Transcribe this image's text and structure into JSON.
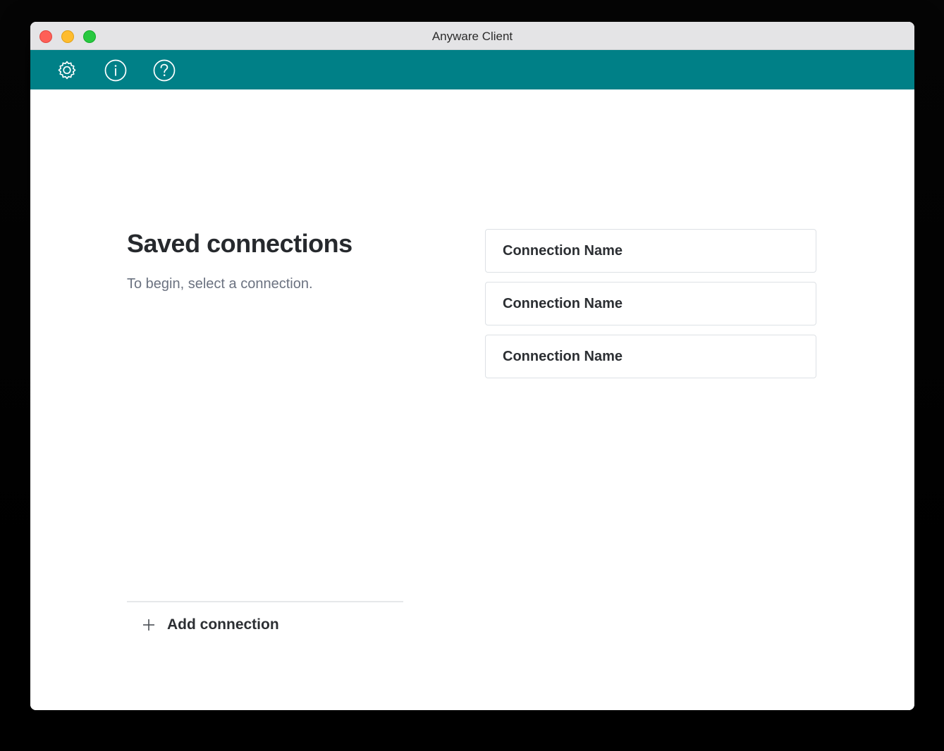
{
  "window": {
    "title": "Anyware Client"
  },
  "toolbar": {
    "icons": [
      "gear-icon",
      "info-icon",
      "help-icon"
    ],
    "color": "#008087"
  },
  "main": {
    "heading": "Saved connections",
    "subtext": "To begin, select a connection.",
    "connections": [
      {
        "label": "Connection Name"
      },
      {
        "label": "Connection Name"
      },
      {
        "label": "Connection Name"
      }
    ],
    "add_label": "Add connection"
  }
}
